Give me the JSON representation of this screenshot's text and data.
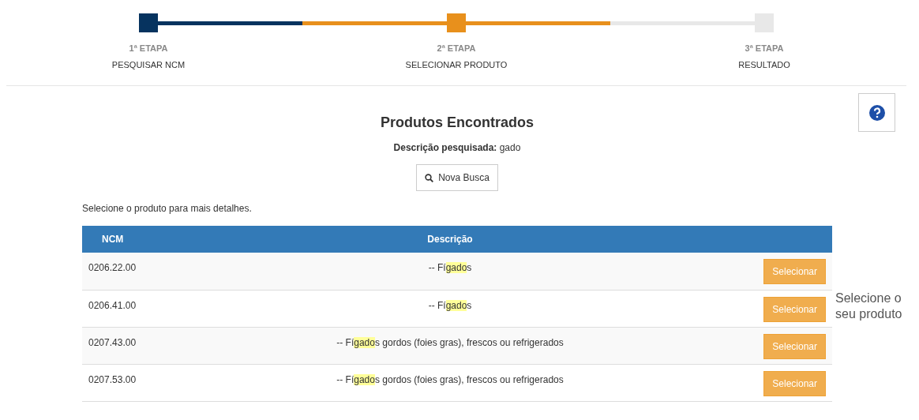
{
  "steps": [
    {
      "number": "1ª ETAPA",
      "label": "PESQUISAR NCM",
      "selected": false
    },
    {
      "number": "2ª ETAPA",
      "label": "SELECIONAR PRODUTO",
      "selected": true
    },
    {
      "number": "3ª ETAPA",
      "label": "RESULTADO",
      "selected": false
    }
  ],
  "title": "Produtos Encontrados",
  "search_summary": {
    "label": "Descrição pesquisada:",
    "value": "gado"
  },
  "new_search_button": "Nova Busca",
  "instruction": "Selecione o produto para mais detalhes.",
  "table": {
    "columns": [
      "NCM",
      "Descrição"
    ],
    "rows": [
      {
        "ncm": "0206.22.00",
        "description": {
          "before": "-- Fí",
          "match": "gado",
          "after": "s"
        },
        "button": "Selecionar"
      },
      {
        "ncm": "0206.41.00",
        "description": {
          "before": "-- Fí",
          "match": "gado",
          "after": "s"
        },
        "button": "Selecionar"
      },
      {
        "ncm": "0207.43.00",
        "description": {
          "before": "-- Fí",
          "match": "gado",
          "after": "s gordos (foies gras), frescos ou refrigerados"
        },
        "button": "Selecionar"
      },
      {
        "ncm": "0207.53.00",
        "description": {
          "before": "-- Fí",
          "match": "gado",
          "after": "s gordos (foies gras), frescos ou refrigerados"
        },
        "button": "Selecionar"
      }
    ]
  },
  "side_hint": "Selecione o seu produto"
}
